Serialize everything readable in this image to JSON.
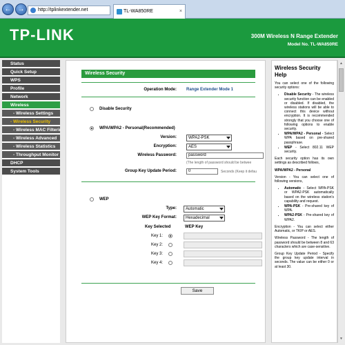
{
  "browser": {
    "url": "http://tplinkextender.net",
    "tab_title": "TL-WA850RE",
    "tab_close": "×"
  },
  "header": {
    "logo": "TP-LINK",
    "product": "300M Wireless N Range Extender",
    "model": "Model No. TL-WA850RE"
  },
  "menu": [
    {
      "label": "Status"
    },
    {
      "label": "Quick Setup"
    },
    {
      "label": "WPS"
    },
    {
      "label": "Profile"
    },
    {
      "label": "Network"
    },
    {
      "label": "Wireless"
    },
    {
      "label": "- Wireless Settings"
    },
    {
      "label": "- Wireless Security"
    },
    {
      "label": "- Wireless MAC Filtering"
    },
    {
      "label": "- Wireless Advanced"
    },
    {
      "label": "- Wireless Statistics"
    },
    {
      "label": "- Throughput Monitor"
    },
    {
      "label": "DHCP"
    },
    {
      "label": "System Tools"
    }
  ],
  "main": {
    "section_title": "Wireless Security",
    "operation_mode_label": "Operation Mode:",
    "operation_mode_value": "Range Extender Mode 1",
    "disable_label": "Disable Security",
    "wpa_label": "WPA/WPA2 - Personal(Recommended)",
    "version_label": "Version:",
    "version_value": "WPA2-PSK",
    "encryption_label": "Encryption:",
    "encryption_value": "AES",
    "password_label": "Wireless Password:",
    "password_value": "password",
    "password_hint": "(The length of password should be betwee",
    "group_key_label": "Group Key Update Period:",
    "group_key_value": "0",
    "group_key_hint": "Seconds (Keep it defau",
    "wep_label": "WEP",
    "type_label": "Type:",
    "type_value": "Automatic",
    "wep_format_label": "WEP Key Format:",
    "wep_format_value": "Hexadecimal",
    "key_selected_label": "Key Selected",
    "wep_key_label": "WEP Key",
    "keys": [
      "Key 1:",
      "Key 2:",
      "Key 3:",
      "Key 4:"
    ],
    "save_label": "Save"
  },
  "help": {
    "title": "Wireless Security Help",
    "intro": "You can select one of the following security options:",
    "options": [
      {
        "name": "Disable Security",
        "desc": " - The wireless security function can be enabled or disabled. If disabled, the wireless stations will be able to connect this device without encryption. It is recommended strongly that you choose one of following options to enable security."
      },
      {
        "name": "WPA/WPA2 - Personal",
        "desc": " - Select WPA based on pre-shared passphrase."
      },
      {
        "name": "WEP",
        "desc": " - Select 802.11 WEP security."
      }
    ],
    "note": "Each security option has its own settings as described follows,",
    "wpa_heading": "WPA/WPA2 - Personal",
    "version_text": "Version - You can select one of following versions,",
    "versions": [
      {
        "name": "Automatic",
        "desc": " - Select WPA-PSK or WPA2-PSK automatically based on the wireless station's capability and request."
      },
      {
        "name": "WPA-PSK",
        "desc": " - Pre-shared key of WPA."
      },
      {
        "name": "WPA2-PSK",
        "desc": " - Pre-shared key of WPA2."
      }
    ],
    "encryption_text": "Encryption - You can select either Automatic, or TKIP or AES.",
    "password_text": "Wireless Password - The length of password should be between 8 and 63 characters which are case-sensitive.",
    "group_key_text": "Group Key Update Period - Specify the group key update interval in seconds. The value can be either 0 or at least 30."
  }
}
